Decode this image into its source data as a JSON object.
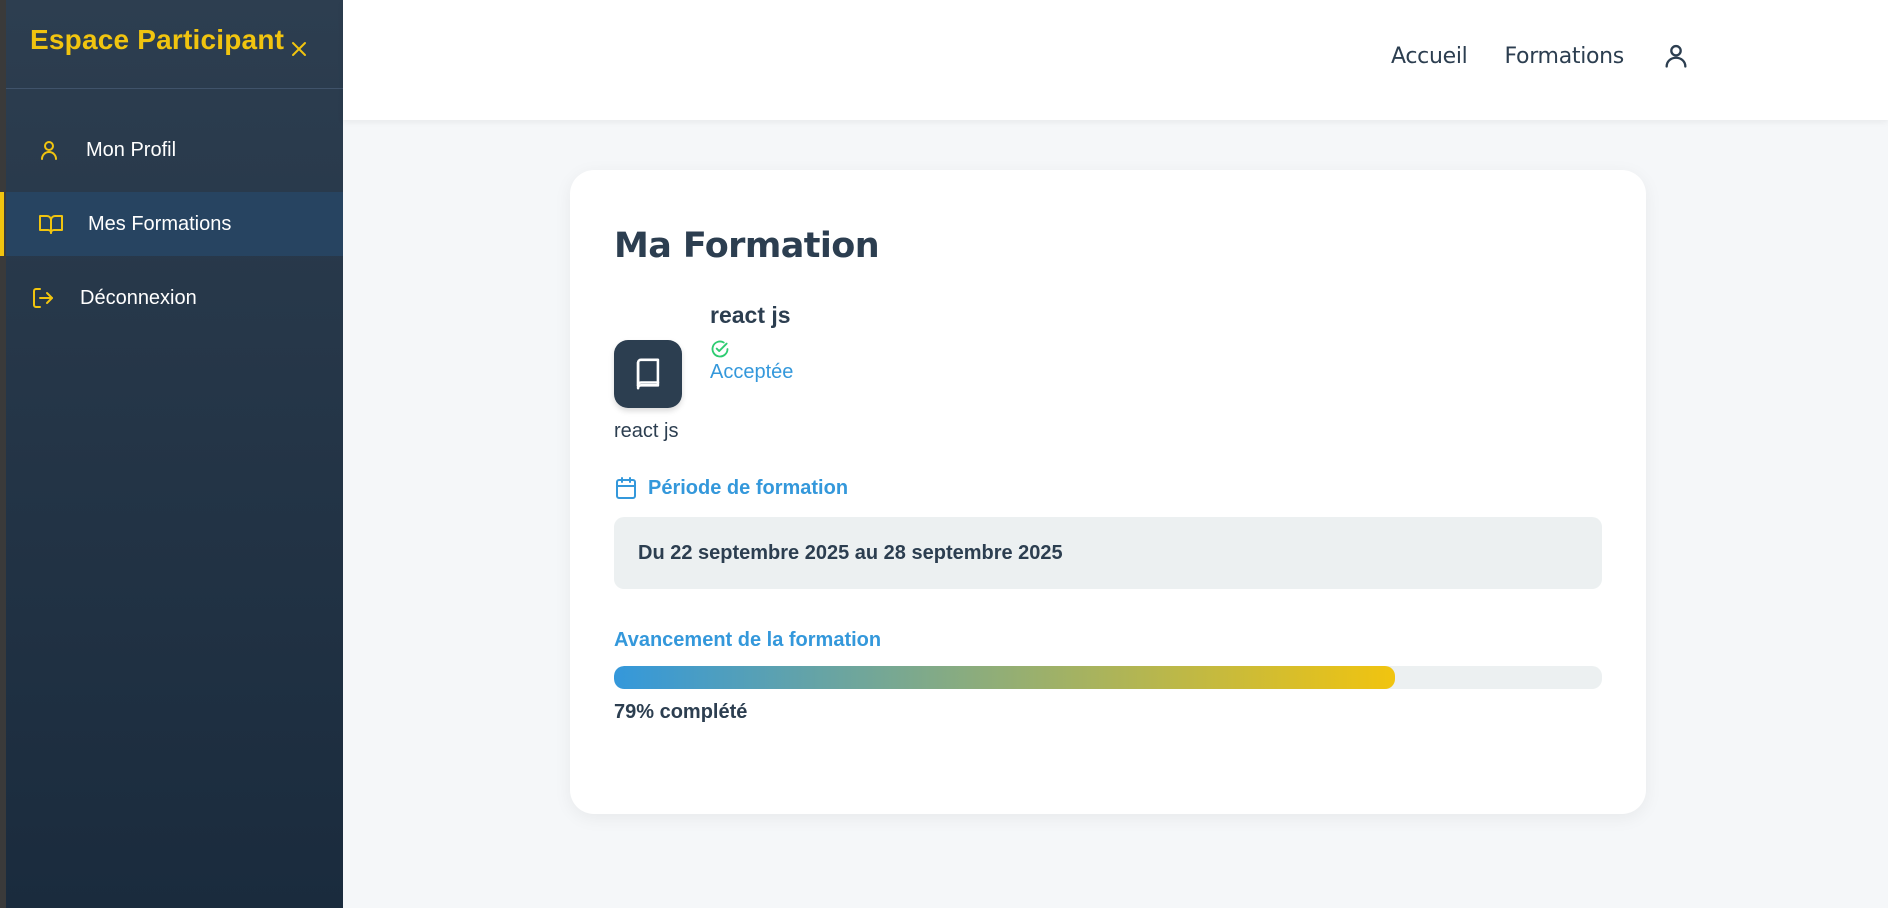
{
  "sidebar": {
    "brand": "Espace Participant",
    "close_icon": "close-icon",
    "items": [
      {
        "label": "Mon Profil",
        "icon": "user-icon",
        "active": false
      },
      {
        "label": "Mes Formations",
        "icon": "book-open-icon",
        "active": true
      },
      {
        "label": "Déconnexion",
        "icon": "logout-icon",
        "active": false
      }
    ]
  },
  "topnav": {
    "links": [
      {
        "label": "Accueil"
      },
      {
        "label": "Formations"
      }
    ],
    "user_icon": "user-icon"
  },
  "card": {
    "title": "Ma Formation",
    "course": {
      "name": "react js",
      "icon": "book-icon",
      "status": "Acceptée",
      "status_icon": "check-circle-icon"
    },
    "description": "react js",
    "period": {
      "label": "Période de formation",
      "icon": "calendar-icon",
      "value": "Du 22 septembre 2025 au 28 septembre 2025"
    },
    "progress": {
      "label": "Avancement de la formation",
      "percent": 79,
      "text": "79% complété"
    }
  },
  "colors": {
    "sidebar_top": "#2d3e50",
    "sidebar_bottom": "#1a2b3d",
    "accent_yellow": "#f1c40f",
    "accent_blue": "#3498db",
    "text_dark": "#2c3e50",
    "success_green": "#2ecc71",
    "active_item_bg": "#274461"
  }
}
